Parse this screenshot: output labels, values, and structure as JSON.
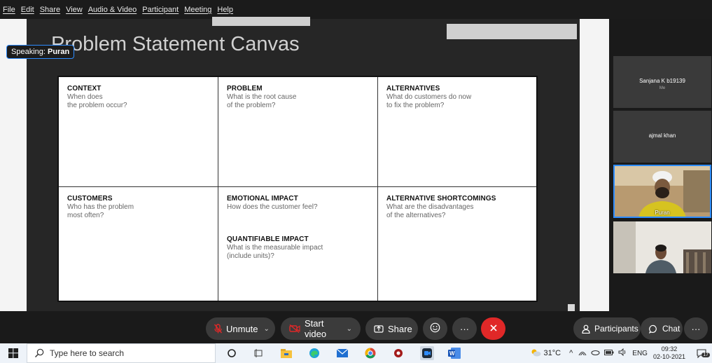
{
  "menu": [
    "File",
    "Edit",
    "Share",
    "View",
    "Audio & Video",
    "Participant",
    "Meeting",
    "Help"
  ],
  "speaking": {
    "prefix": "Speaking:",
    "name": "Puran"
  },
  "slide": {
    "title": "Problem Statement Canvas",
    "cells": [
      {
        "title": "CONTEXT",
        "text": "When does\nthe problem occur?"
      },
      {
        "title": "PROBLEM",
        "text": "What is the root cause\nof the problem?"
      },
      {
        "title": "ALTERNATIVES",
        "text": "What do customers do now\nto fix the problem?"
      },
      {
        "title": "CUSTOMERS",
        "text": "Who has the problem\nmost often?"
      },
      {
        "title": "EMOTIONAL IMPACT",
        "text": "How does the customer feel?",
        "sub_title": "QUANTIFIABLE IMPACT",
        "sub_text": "What is the measurable impact\n(include units)?"
      },
      {
        "title": "ALTERNATIVE SHORTCOMINGS",
        "text": "What are the disadvantages\nof the alternatives?"
      }
    ]
  },
  "participants": [
    {
      "name": "Sanjana K b19139",
      "sub": "Me"
    },
    {
      "name": "ajmal khan",
      "sub": ""
    },
    {
      "name": "Puran",
      "sub": ""
    },
    {
      "name": "",
      "sub": ""
    }
  ],
  "controls": {
    "unmute": "Unmute",
    "start_video": "Start video",
    "share": "Share",
    "more": "···",
    "participants": "Participants",
    "chat": "Chat"
  },
  "taskbar": {
    "search_placeholder": "Type here to search",
    "weather": "31°C",
    "lang": "ENG",
    "time": "09:32",
    "date": "02-10-2021",
    "notif_count": "17"
  },
  "colors": {
    "accent": "#2d8cff",
    "end": "#e02828"
  }
}
